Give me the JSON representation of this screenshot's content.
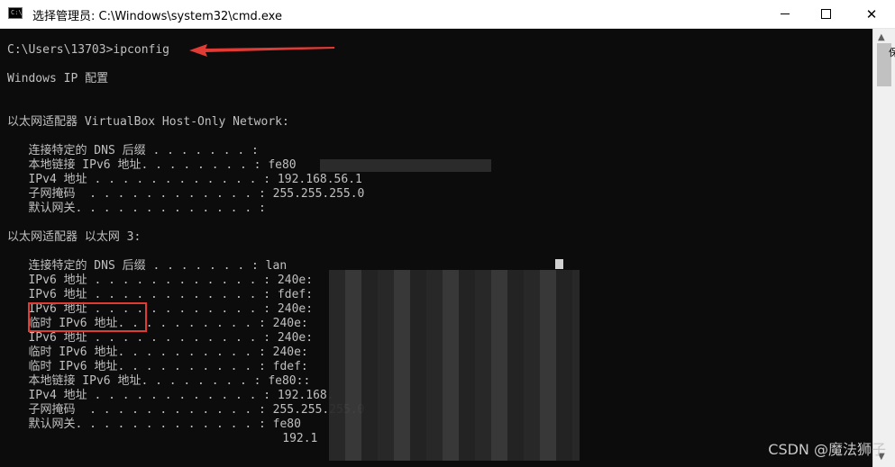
{
  "window": {
    "title": "选择管理员: C:\\Windows\\system32\\cmd.exe",
    "icon_label": "C:\\",
    "minimize": "—",
    "maximize": "□",
    "close": "✕"
  },
  "console_lines": [
    "C:\\Users\\13703>ipconfig",
    "Windows IP 配置",
    "以太网适配器 VirtualBox Host-Only Network:",
    "   连接特定的 DNS 后缀 . . . . . . . :",
    "   本地链接 IPv6 地址. . . . . . . . : fe80",
    "   IPv4 地址 . . . . . . . . . . . . : 192.168.56.1",
    "   子网掩码  . . . . . . . . . . . . : 255.255.255.0",
    "   默认网关. . . . . . . . . . . . . :",
    "以太网适配器 以太网 3:",
    "   连接特定的 DNS 后缀 . . . . . . . : lan",
    "   IPv6 地址 . . . . . . . . . . . . : 240e:",
    "   IPv6 地址 . . . . . . . . . . . . : fdef:",
    "   IPv6 地址 . . . . . . . . . . . . : 240e:",
    "   临时 IPv6 地址. . . . . . . . . . : 240e:",
    "   IPv6 地址 . . . . . . . . . . . . : 240e:",
    "   临时 IPv6 地址. . . . . . . . . . : 240e:",
    "   临时 IPv6 地址. . . . . . . . . . : fdef:",
    "   本地链接 IPv6 地址. . . . . . . . : fe80::",
    "   IPv4 地址 . . . . . . . . . . . . : 192.168.",
    "   子网掩码  . . . . . . . . . . . . : 255.255.255.0",
    "   默认网关. . . . . . . . . . . . . : fe80",
    "                                       192.1"
  ],
  "side_fragment": "保",
  "watermark": "CSDN @魔法狮子",
  "colors": {
    "console_bg": "#0c0c0c",
    "console_text": "#c0c0c0",
    "annotation_red": "#e03b35"
  }
}
